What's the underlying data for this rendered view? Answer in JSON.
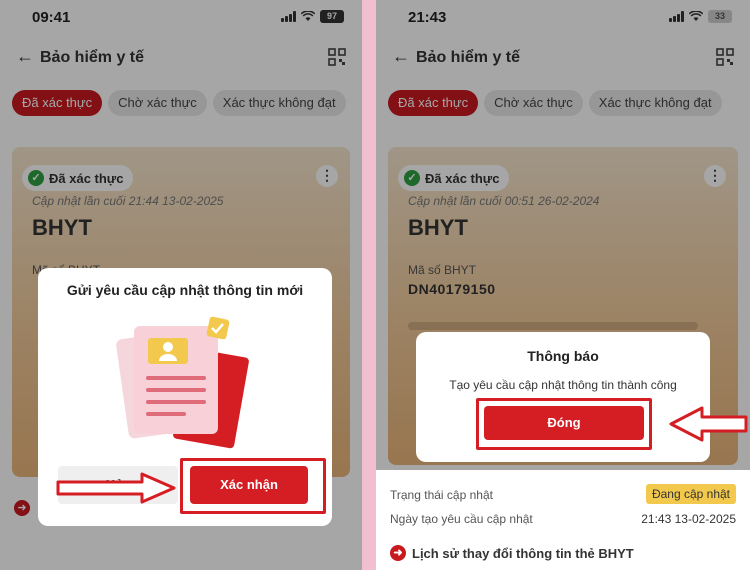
{
  "phone1": {
    "time": "09:41",
    "battery": "97",
    "header": {
      "title": "Bảo hiểm y tế"
    },
    "tabs": [
      {
        "label": "Đã xác thực",
        "active": true
      },
      {
        "label": "Chờ xác thực",
        "active": false
      },
      {
        "label": "Xác thực không đạt",
        "active": false
      }
    ],
    "card": {
      "badge": "Đã xác thực",
      "updated": "Cập nhật lần cuối 21:44 13-02-2025",
      "title": "BHYT",
      "field_label": "Mã số BHYT"
    },
    "dialog": {
      "title": "Gửi yêu cầu cập nhật thông tin mới",
      "cancel_label": "Hủy",
      "confirm_label": "Xác nhận"
    }
  },
  "phone2": {
    "time": "21:43",
    "battery": "33",
    "header": {
      "title": "Bảo hiểm y tế"
    },
    "tabs": [
      {
        "label": "Đã xác thực",
        "active": true
      },
      {
        "label": "Chờ xác thực",
        "active": false
      },
      {
        "label": "Xác thực không đạt",
        "active": false
      }
    ],
    "card": {
      "badge": "Đã xác thực",
      "updated": "Cập nhật lần cuối 00:51 26-02-2024",
      "title": "BHYT",
      "field_label": "Mã số BHYT",
      "field_value": "DN40179150"
    },
    "info": {
      "status_label": "Trạng thái cập nhật",
      "status_value": "Đang cập nhật",
      "date_label": "Ngày tạo yêu cầu cập nhật",
      "date_value": "21:43 13-02-2025"
    },
    "history_label": "Lịch sử thay đổi thông tin thẻ BHYT",
    "dialog": {
      "title": "Thông báo",
      "message": "Tạo yêu cầu cập nhật thông tin thành công",
      "close_label": "Đóng"
    }
  },
  "colors": {
    "brand_red": "#c8191f",
    "status_yellow": "#f2c94c",
    "verified_green": "#2ea043"
  }
}
